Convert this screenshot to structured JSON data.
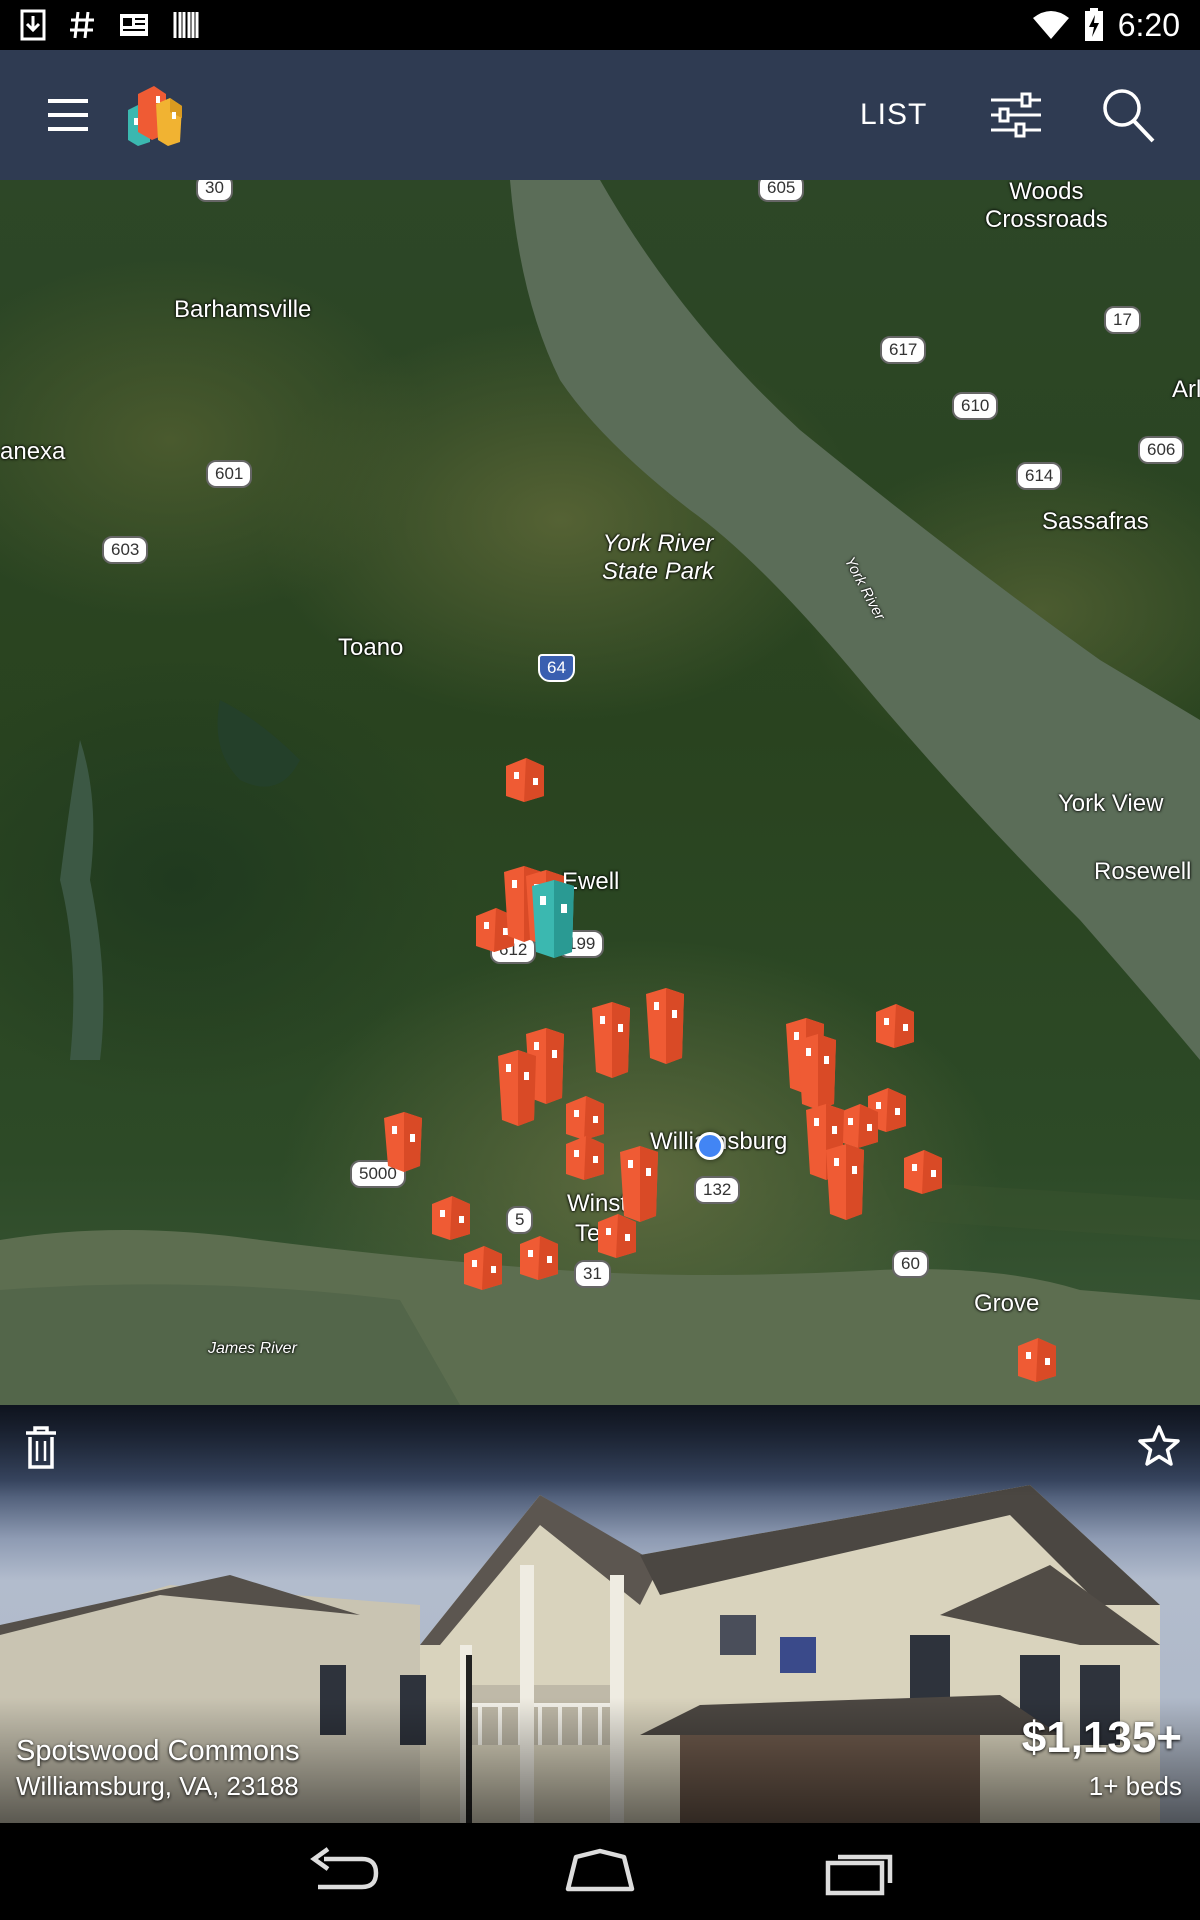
{
  "status_bar": {
    "time": "6:20",
    "left_icons": [
      "download-icon",
      "hash-icon",
      "news-icon",
      "barcode-icon"
    ],
    "right_icons": [
      "wifi-icon",
      "battery-charging-icon"
    ]
  },
  "app_bar": {
    "list_label": "LIST",
    "icons": [
      "menu-icon",
      "app-logo",
      "filter-icon",
      "search-icon"
    ],
    "background": "#2f3b52"
  },
  "map": {
    "places": [
      {
        "name": "Woods Crossroads",
        "lines": [
          "Woods",
          "Crossroads"
        ]
      },
      {
        "name": "Barhamsville"
      },
      {
        "name": "anexa"
      },
      {
        "name": "Arl"
      },
      {
        "name": "Sassafras"
      },
      {
        "name": "York River State Park",
        "lines": [
          "York River",
          "State Park"
        ]
      },
      {
        "name": "York River"
      },
      {
        "name": "Toano"
      },
      {
        "name": "York View"
      },
      {
        "name": "Rosewell"
      },
      {
        "name": "Ewell"
      },
      {
        "name": "Williamsburg"
      },
      {
        "name": "Winsto"
      },
      {
        "name": "Te"
      },
      {
        "name": "Grove"
      },
      {
        "name": "James River"
      }
    ],
    "route_shields": [
      "30",
      "605",
      "17",
      "617",
      "610",
      "606",
      "614",
      "601",
      "603",
      "64",
      "5000",
      "5",
      "132",
      "31",
      "60",
      "199",
      "612"
    ],
    "pin_color": "#ef5b34",
    "selected_pin_color": "#3bb8b0"
  },
  "listing": {
    "name": "Spotswood Commons",
    "address": "Williamsburg, VA, 23188",
    "price": "$1,135+",
    "beds": "1+ beds",
    "icons": [
      "trash-icon",
      "star-icon"
    ]
  },
  "nav_bar": {
    "icons": [
      "back-icon",
      "home-icon",
      "recents-icon"
    ]
  }
}
